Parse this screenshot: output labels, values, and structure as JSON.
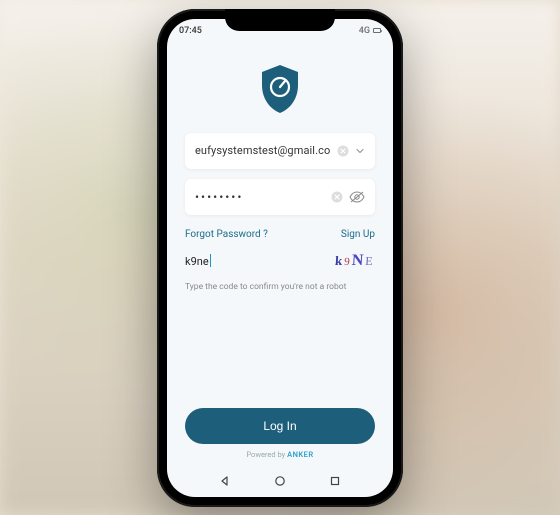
{
  "status": {
    "time": "07:45",
    "signal": "4G"
  },
  "login": {
    "email_value": "eufysystemstest@gmail.com",
    "password_value": "••••••••",
    "forgot_label": "Forgot Password ?",
    "signup_label": "Sign Up",
    "captcha_input": "k9ne",
    "captcha_display": "k9NE",
    "captcha_hint": "Type the code to confirm you're not a robot",
    "login_label": "Log In"
  },
  "footer": {
    "powered_prefix": "Powered by ",
    "powered_brand": "ANKER"
  }
}
